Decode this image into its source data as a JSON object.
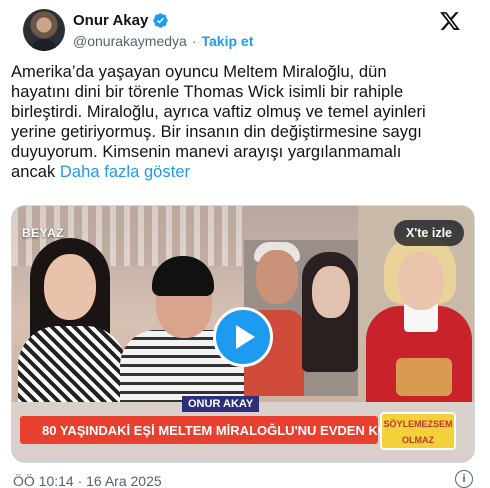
{
  "author": {
    "display_name": "Onur Akay",
    "handle": "@onurakaymedya",
    "separator": "·",
    "follow_label": "Takip et",
    "verified_color": "#1d9bf0"
  },
  "tweet": {
    "lines": [
      "Amerika’da yaşayan oyuncu Meltem Miraloğlu, dün",
      "hayatını dini bir törenle Thomas Wick isimli bir rahiple",
      "birleştirdi. Miraloğlu, ayrıca vaftiz olmuş ve temel ayinleri",
      "yerine getiriyormuş. Bir insanın din değiştirmesine saygı",
      "duyuyorum. Kimsenin manevi arayışı yargılanmamalı"
    ],
    "last_line_prefix": "ancak ",
    "more_label": "Daha fazla göster"
  },
  "media": {
    "watch_label": "X'te izle",
    "channel_logo": "BEYAZ",
    "caption_name": "ONUR AKAY",
    "caption_headline": "80 YAŞINDAKİ EŞİ MELTEM MİRALOĞLU'NU EVDEN KOVDU!",
    "show_badge_line1": "SÖYLEMEZSEM",
    "show_badge_line2": "OLMAZ",
    "play_icon": "play-icon"
  },
  "footer": {
    "timestamp": "ÖÖ 10:14 · 16 Ara 2025",
    "info_icon": "info-icon"
  },
  "colors": {
    "accent": "#1d9bf0",
    "text": "#0f1419",
    "secondary_text": "#536471",
    "caption_red": "#e8402e"
  }
}
